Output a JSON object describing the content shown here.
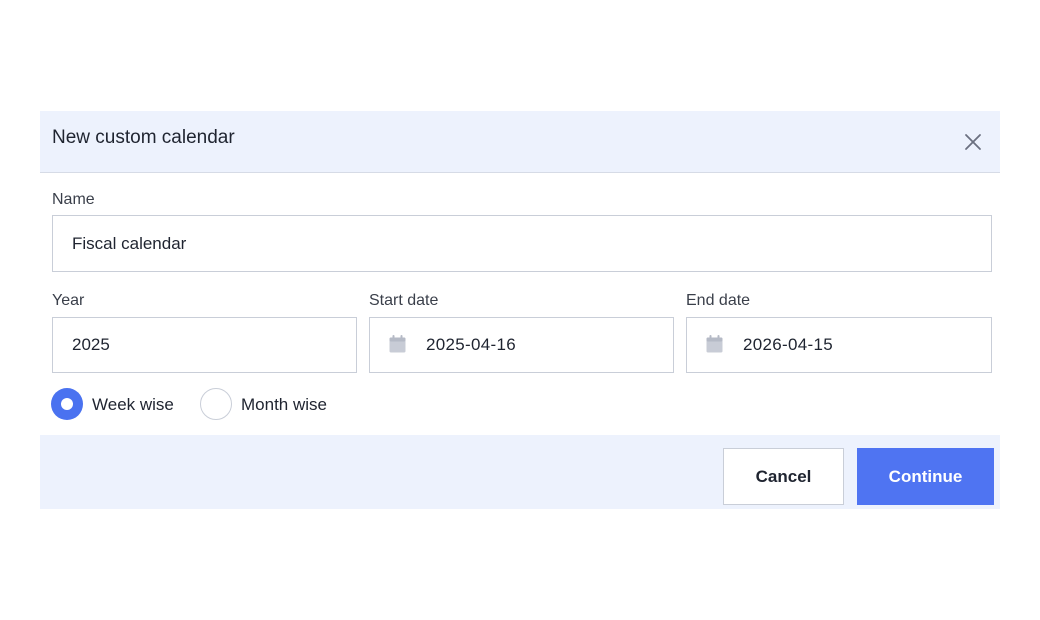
{
  "dialog": {
    "title": "New custom calendar",
    "close_icon": "close-icon"
  },
  "form": {
    "name_label": "Name",
    "name_value": "Fiscal calendar",
    "year_label": "Year",
    "year_value": "2025",
    "start_label": "Start date",
    "start_value": "2025-04-16",
    "end_label": "End date",
    "end_value": "2026-04-15",
    "calendar_icon": "calendar-icon"
  },
  "mode": {
    "options": [
      {
        "label": "Week wise",
        "selected": true
      },
      {
        "label": "Month wise",
        "selected": false
      }
    ]
  },
  "footer": {
    "cancel_label": "Cancel",
    "continue_label": "Continue"
  },
  "colors": {
    "accent": "#4f74f2",
    "header_bg": "#edf2fd",
    "border": "#c9ced8"
  }
}
